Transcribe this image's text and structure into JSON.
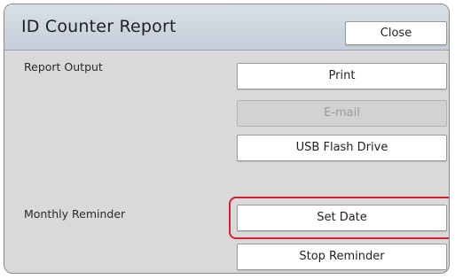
{
  "window": {
    "title": "ID Counter Report",
    "close_label": "Close"
  },
  "report_output": {
    "label": "Report Output",
    "buttons": {
      "print": "Print",
      "email": "E-mail",
      "usb": "USB Flash Drive"
    }
  },
  "monthly_reminder": {
    "label": "Monthly Reminder",
    "buttons": {
      "set_date": "Set Date",
      "stop_reminder": "Stop Reminder"
    }
  },
  "colors": {
    "highlight": "#d4202f",
    "header": "#c5ced9",
    "panel": "#d9d9d9"
  }
}
